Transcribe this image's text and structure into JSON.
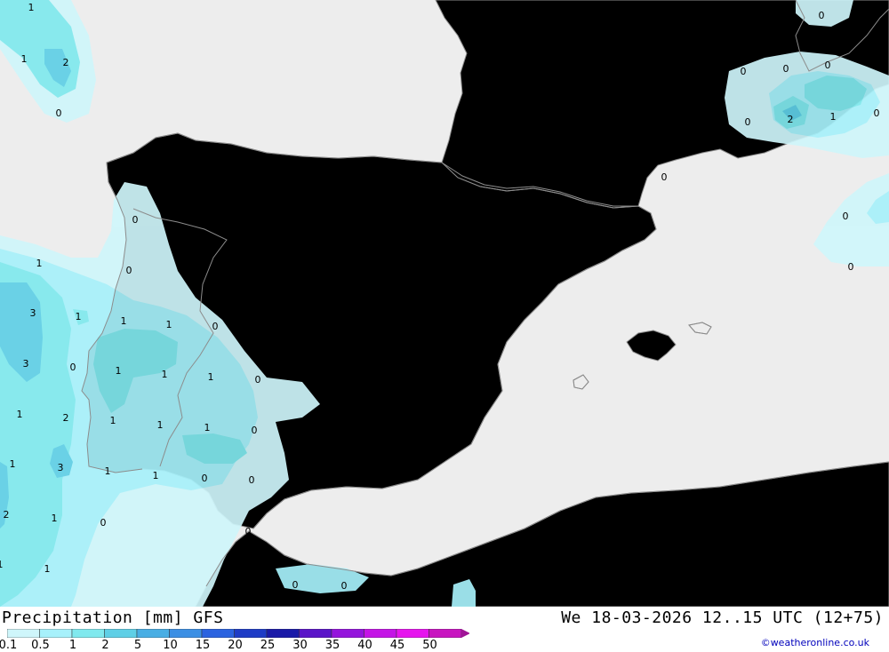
{
  "map": {
    "colors": {
      "sea": "#ededed",
      "land": "#c9fca6",
      "border": "#8c8c8c",
      "precip_0_1": "#cff6fb",
      "precip_0_5": "#a7f1fb",
      "precip_1": "#80e9ee",
      "precip_2": "#5fcfe6",
      "precip_5": "#49aee4"
    },
    "contour_labels": [
      {
        "text": "1"
      },
      {
        "text": "1"
      },
      {
        "text": "2"
      },
      {
        "text": "0"
      },
      {
        "text": "0"
      },
      {
        "text": "0"
      },
      {
        "text": "0"
      },
      {
        "text": "0"
      },
      {
        "text": "0"
      },
      {
        "text": "2"
      },
      {
        "text": "1"
      },
      {
        "text": "0"
      },
      {
        "text": "0"
      },
      {
        "text": "0"
      },
      {
        "text": "0"
      },
      {
        "text": "0"
      },
      {
        "text": "1"
      },
      {
        "text": "0"
      },
      {
        "text": "3"
      },
      {
        "text": "1"
      },
      {
        "text": "1"
      },
      {
        "text": "1"
      },
      {
        "text": "0"
      },
      {
        "text": "3"
      },
      {
        "text": "0"
      },
      {
        "text": "1"
      },
      {
        "text": "1"
      },
      {
        "text": "1"
      },
      {
        "text": "0"
      },
      {
        "text": "1"
      },
      {
        "text": "2"
      },
      {
        "text": "1"
      },
      {
        "text": "1"
      },
      {
        "text": "1"
      },
      {
        "text": "0"
      },
      {
        "text": "1"
      },
      {
        "text": "3"
      },
      {
        "text": "1"
      },
      {
        "text": "1"
      },
      {
        "text": "0"
      },
      {
        "text": "0"
      },
      {
        "text": "2"
      },
      {
        "text": "1"
      },
      {
        "text": "0"
      },
      {
        "text": "0"
      },
      {
        "text": "1"
      },
      {
        "text": "0"
      },
      {
        "text": "0"
      },
      {
        "text": "1"
      }
    ]
  },
  "footer": {
    "title": "Precipitation [mm] GFS",
    "datetime": "We 18-03-2026 12..15 UTC (12+75)",
    "credit": "©weatheronline.co.uk",
    "legend": {
      "labels": [
        "0.1",
        "0.5",
        "1",
        "2",
        "5",
        "10",
        "15",
        "20",
        "25",
        "30",
        "35",
        "40",
        "45",
        "50"
      ],
      "colors": [
        "#cff6fb",
        "#a7f1fb",
        "#80e9ee",
        "#5fcfe6",
        "#49aee4",
        "#3c8fe4",
        "#2b63e0",
        "#1e3cc6",
        "#1a1aa8",
        "#5a14c8",
        "#9414dc",
        "#c414e6",
        "#e614ee",
        "#c814c0"
      ],
      "arrow_color": "#a01496"
    }
  }
}
